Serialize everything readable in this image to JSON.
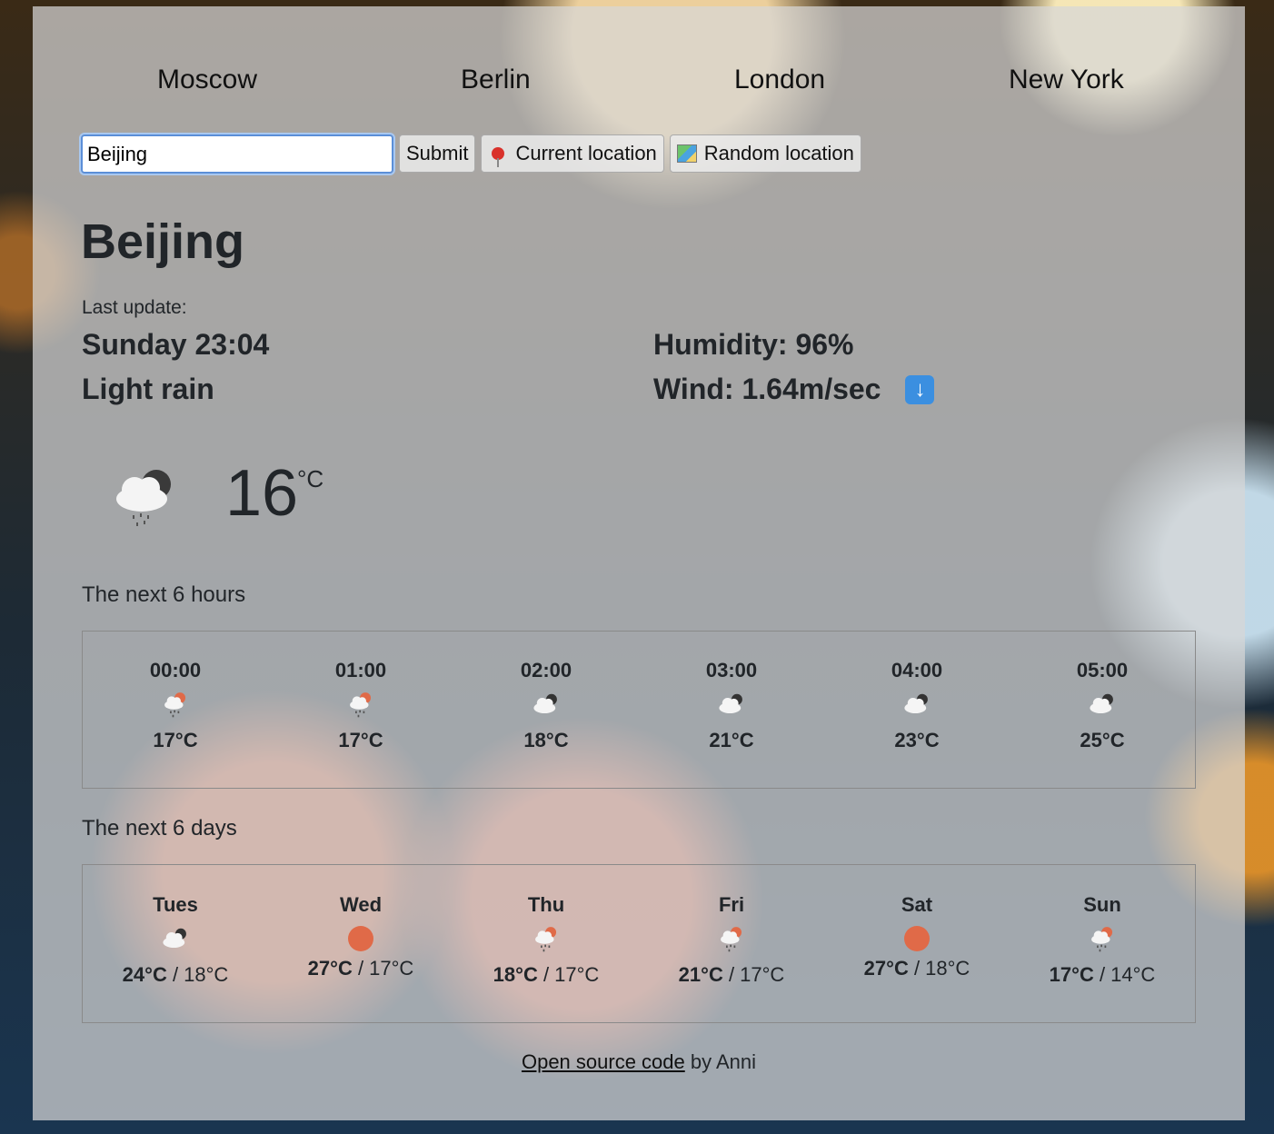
{
  "cities": [
    "Moscow",
    "Berlin",
    "London",
    "New York"
  ],
  "search": {
    "value": "Beijing",
    "submit_label": "Submit",
    "current_label": "Current location",
    "random_label": "Random location"
  },
  "weather": {
    "city": "Beijing",
    "last_update_label": "Last update:",
    "datetime": "Sunday 23:04",
    "description": "Light rain",
    "humidity": "Humidity: 96%",
    "wind": "Wind: 1.64m/sec",
    "temperature": "16",
    "unit": "°C"
  },
  "hours_title": "The next 6 hours",
  "hours": [
    {
      "time": "00:00",
      "temp": "17°C",
      "icon": "rain-sun-icon"
    },
    {
      "time": "01:00",
      "temp": "17°C",
      "icon": "rain-sun-icon"
    },
    {
      "time": "02:00",
      "temp": "18°C",
      "icon": "cloud-icon"
    },
    {
      "time": "03:00",
      "temp": "21°C",
      "icon": "cloud-icon"
    },
    {
      "time": "04:00",
      "temp": "23°C",
      "icon": "cloud-icon"
    },
    {
      "time": "05:00",
      "temp": "25°C",
      "icon": "cloud-icon"
    }
  ],
  "days_title": "The next 6 days",
  "days": [
    {
      "day": "Tues",
      "max": "24°C",
      "min": " / 18°C",
      "icon": "cloud-icon"
    },
    {
      "day": "Wed",
      "max": "27°C",
      "min": " / 17°C",
      "icon": "sun-icon"
    },
    {
      "day": "Thu",
      "max": "18°C",
      "min": " / 17°C",
      "icon": "rain-sun-icon"
    },
    {
      "day": "Fri",
      "max": "21°C",
      "min": " / 17°C",
      "icon": "rain-sun-icon"
    },
    {
      "day": "Sat",
      "max": "27°C",
      "min": " / 18°C",
      "icon": "sun-icon"
    },
    {
      "day": "Sun",
      "max": "17°C",
      "min": " / 14°C",
      "icon": "rain-sun-icon"
    }
  ],
  "footer": {
    "link": "Open source code",
    "suffix": " by Anni"
  }
}
